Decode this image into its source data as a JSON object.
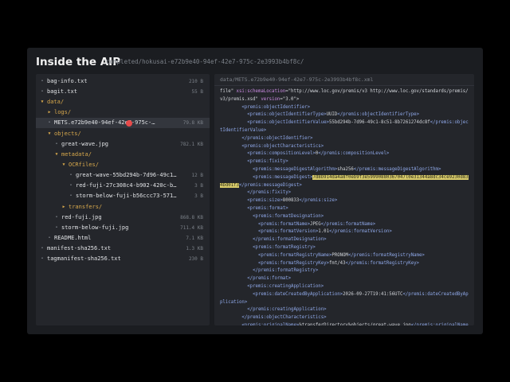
{
  "header": {
    "title": "Inside the AIP",
    "path": "completed/hokusai-e72b9e40-94ef-42e7-975c-2e3993b4bf8c/"
  },
  "tree": [
    {
      "label": "bag-info.txt",
      "kind": "file",
      "size": "210 B"
    },
    {
      "label": "bagit.txt",
      "kind": "file",
      "size": "55 B"
    },
    {
      "label": "data/",
      "kind": "folder",
      "arrow": "▼"
    },
    {
      "label": "logs/",
      "kind": "folder",
      "arrow": "▶"
    },
    {
      "label": "METS.e72b9e40-94ef-42e7-975c-2e3993b4bf8c.xml",
      "kind": "file",
      "size": "79.8 KB",
      "selected": true
    },
    {
      "label": "objects/",
      "kind": "folder",
      "arrow": "▼"
    },
    {
      "label": "great-wave.jpg",
      "kind": "file",
      "size": "782.1 KB"
    },
    {
      "label": "metadata/",
      "kind": "folder",
      "arrow": "▼"
    },
    {
      "label": "OCRfiles/",
      "kind": "folder",
      "arrow": "▼"
    },
    {
      "label": "great-wave-55bd294b-7d96-49c1-8c51-8b7261274dc8f.txt",
      "kind": "file",
      "size": "12 B"
    },
    {
      "label": "red-fuji-27c308c4-b902-420c-b4be-1f0e5c6a7d21.txt",
      "kind": "file",
      "size": "3 B"
    },
    {
      "label": "storm-below-fuji-b56ccc73-5718-4e2a-9f1d-3c8b7a6e5d40.txt",
      "kind": "file",
      "size": "3 B"
    },
    {
      "label": "transfers/",
      "kind": "folder",
      "arrow": "▶"
    },
    {
      "label": "red-fuji.jpg",
      "kind": "file",
      "size": "868.8 KB"
    },
    {
      "label": "storm-below-fuji.jpg",
      "kind": "file",
      "size": "711.4 KB"
    },
    {
      "label": "README.html",
      "kind": "file",
      "size": "7.1 KB"
    },
    {
      "label": "manifest-sha256.txt",
      "kind": "file",
      "size": "1.3 KB"
    },
    {
      "label": "tagmanifest-sha256.txt",
      "kind": "file",
      "size": "230 B"
    }
  ],
  "viewer": {
    "path": "data/METS.e72b9e40-94ef-42e7-975c-2e3993b4bf8c.xml",
    "lines": [
      [
        [
          "t",
          "file\" "
        ],
        [
          "a",
          "xsi:schemaLocation"
        ],
        [
          "t",
          "=\"http://www.loc.gov/premis/v3 http://www.loc.gov/standards/premis/v3/premis.xsd\" "
        ],
        [
          "a",
          "version"
        ],
        [
          "t",
          "=\"3.0\">"
        ]
      ],
      [
        [
          "g",
          "        <premis:objectIdentifier>"
        ]
      ],
      [
        [
          "g",
          "          <premis:objectIdentifierType>"
        ],
        [
          "t",
          "UUID"
        ],
        [
          "g",
          "</premis:objectIdentifierType>"
        ]
      ],
      [
        [
          "g",
          "          <premis:objectIdentifierValue>"
        ],
        [
          "t",
          "55bd294b-7d96-49c1-8c51-8b7261274dc8f"
        ],
        [
          "g",
          "</premis:objectIdentifierValue>"
        ]
      ],
      [
        [
          "g",
          "        </premis:objectIdentifier>"
        ]
      ],
      [
        [
          "g",
          "        <premis:objectCharacteristics>"
        ]
      ],
      [
        [
          "g",
          "          <premis:compositionLevel>"
        ],
        [
          "t",
          "0"
        ],
        [
          "g",
          "</premis:compositionLevel>"
        ]
      ],
      [
        [
          "g",
          "          <premis:fixity>"
        ]
      ],
      [
        [
          "g",
          "            <premis:messageDigestAlgorithm>"
        ],
        [
          "t",
          "sha256"
        ],
        [
          "g",
          "</premis:messageDigestAlgorithm>"
        ]
      ],
      [
        [
          "g",
          "            <premis:messageDigest>"
        ],
        [
          "h",
          "7d8b914da4a8f0eb9f3e59990880367047l0e31344a8dc34ce9230d834bd01f3"
        ],
        [
          "g",
          "</premis:messageDigest>"
        ]
      ],
      [
        [
          "g",
          "          </premis:fixity>"
        ]
      ],
      [
        [
          "g",
          "          <premis:size>"
        ],
        [
          "t",
          "800833"
        ],
        [
          "g",
          "</premis:size>"
        ]
      ],
      [
        [
          "g",
          "          <premis:format>"
        ]
      ],
      [
        [
          "g",
          "            <premis:formatDesignation>"
        ]
      ],
      [
        [
          "g",
          "              <premis:formatName>"
        ],
        [
          "t",
          "JPEG"
        ],
        [
          "g",
          "</premis:formatName>"
        ]
      ],
      [
        [
          "g",
          "              <premis:formatVersion>"
        ],
        [
          "t",
          "1.01"
        ],
        [
          "g",
          "</premis:formatVersion>"
        ]
      ],
      [
        [
          "g",
          "            </premis:formatDesignation>"
        ]
      ],
      [
        [
          "g",
          "            <premis:formatRegistry>"
        ]
      ],
      [
        [
          "g",
          "              <premis:formatRegistryName>"
        ],
        [
          "t",
          "PRONOM"
        ],
        [
          "g",
          "</premis:formatRegistryName>"
        ]
      ],
      [
        [
          "g",
          "              <premis:formatRegistryKey>"
        ],
        [
          "t",
          "fmt/43"
        ],
        [
          "g",
          "</premis:formatRegistryKey>"
        ]
      ],
      [
        [
          "g",
          "            </premis:formatRegistry>"
        ]
      ],
      [
        [
          "g",
          "          </premis:format>"
        ]
      ],
      [
        [
          "g",
          "          <premis:creatingApplication>"
        ]
      ],
      [
        [
          "g",
          "            <premis:dateCreatedByApplication>"
        ],
        [
          "t",
          "2026-09-27T19:41:56UTC"
        ],
        [
          "g",
          "</premis:dateCreatedByApplication>"
        ]
      ],
      [
        [
          "g",
          "          </premis:creatingApplication>"
        ]
      ],
      [
        [
          "g",
          "        </premis:objectCharacteristics>"
        ]
      ],
      [
        [
          "g",
          "        <premis:originalName>"
        ],
        [
          "t",
          "%transferDirectory%objects/great-wave.jpg"
        ],
        [
          "g",
          "</premis:originalName>"
        ]
      ],
      [
        [
          "g",
          "        <premis:relationship>"
        ]
      ]
    ]
  }
}
